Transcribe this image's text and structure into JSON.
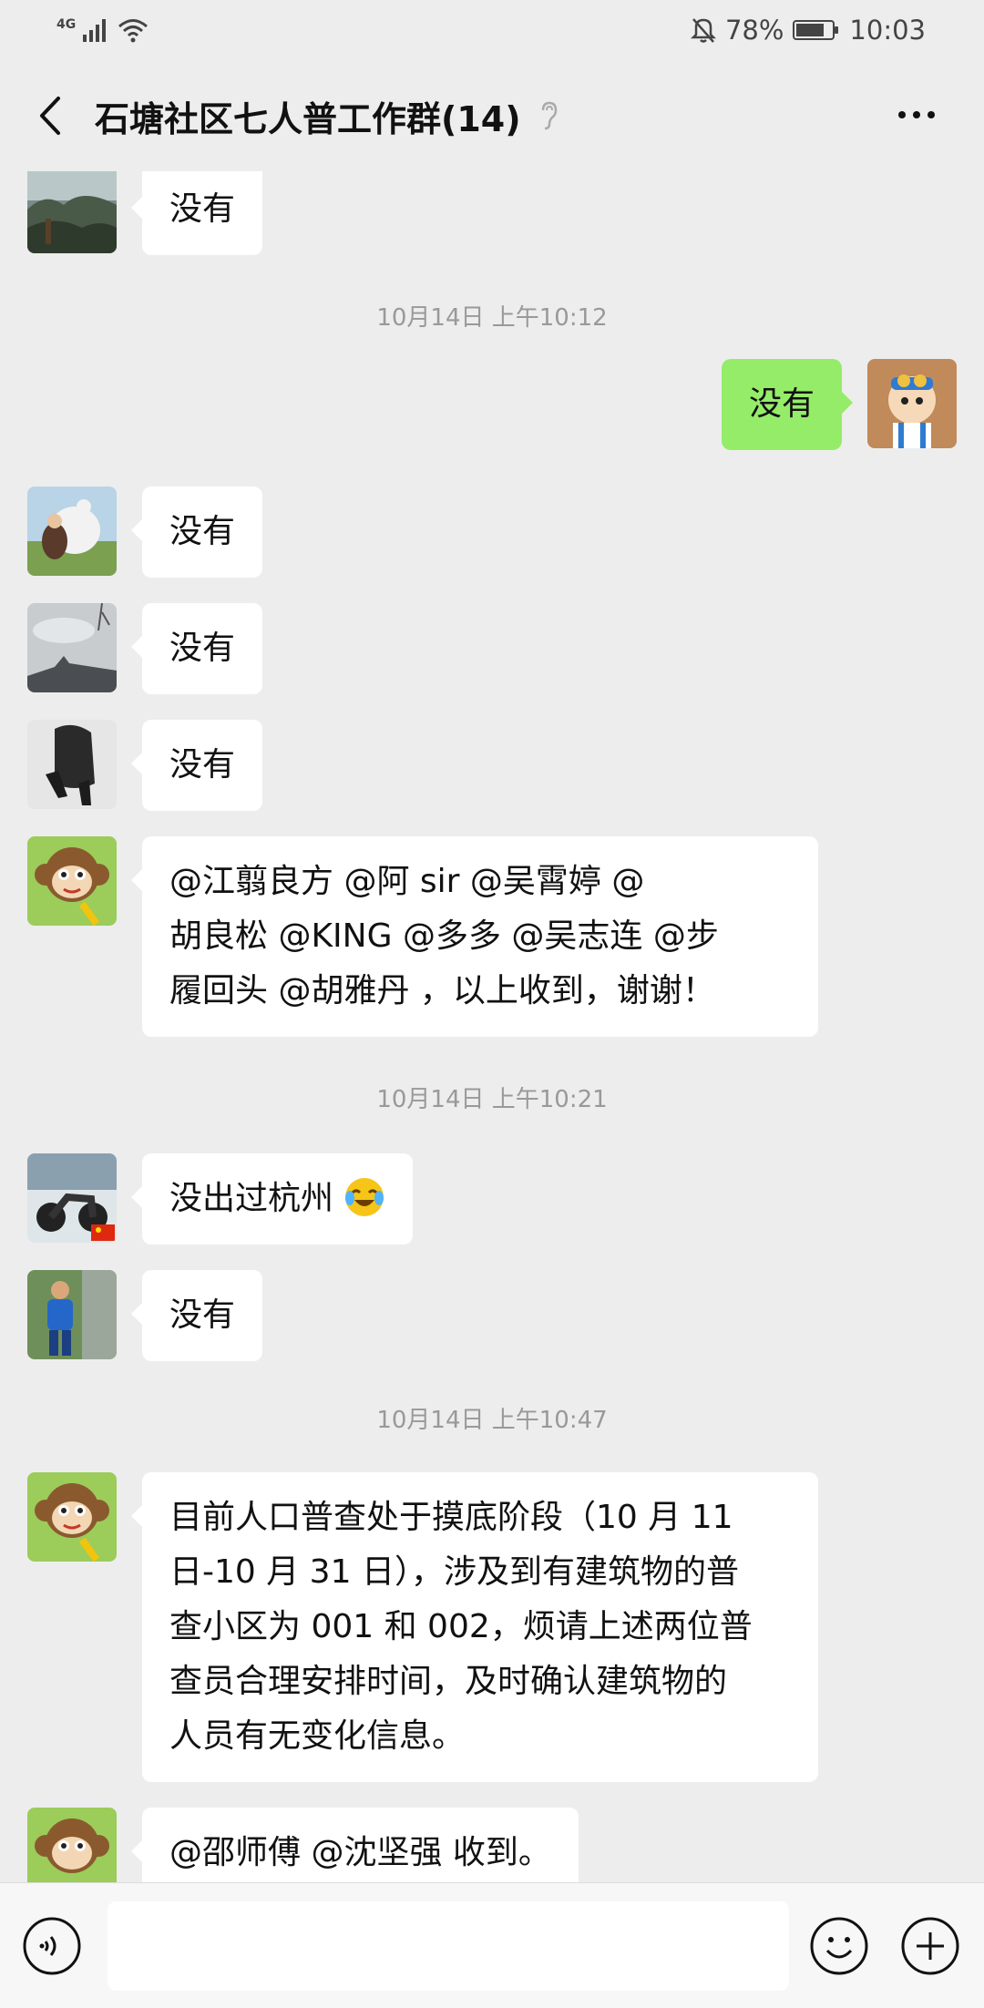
{
  "status_bar": {
    "network": "4G",
    "battery_percent": "78%",
    "time": "10:03"
  },
  "header": {
    "title": "石塘社区七人普工作群(14)"
  },
  "messages": [
    {
      "type": "text",
      "side": "left",
      "avatar": "landscape-avatar",
      "text": "没有"
    },
    {
      "type": "time",
      "text": "10月14日 上午10:12"
    },
    {
      "type": "text",
      "side": "right",
      "avatar": "cartoon-boy-avatar",
      "text": "没有"
    },
    {
      "type": "text",
      "side": "left",
      "avatar": "bear-avatar",
      "text": "没有"
    },
    {
      "type": "text",
      "side": "left",
      "avatar": "sky-avatar",
      "text": "没有"
    },
    {
      "type": "text",
      "side": "left",
      "avatar": "person-avatar",
      "text": "没有"
    },
    {
      "type": "text",
      "side": "left",
      "avatar": "monkey-avatar",
      "lines": [
        "@江翦良方 @阿 sir @吴霄婷 @",
        "胡良松 @KING @多多 @吴志连 @步",
        "履回头 @胡雅丹 ，以上收到，谢谢！"
      ]
    },
    {
      "type": "time",
      "text": "10月14日 上午10:21"
    },
    {
      "type": "text",
      "side": "left",
      "avatar": "motorcycle-avatar",
      "text": "没出过杭州"
    },
    {
      "type": "text",
      "side": "left",
      "avatar": "child-avatar",
      "text": "没有"
    },
    {
      "type": "time",
      "text": "10月14日 上午10:47"
    },
    {
      "type": "text",
      "side": "left",
      "avatar": "monkey-avatar",
      "lines": [
        "目前人口普查处于摸底阶段（10 月 11",
        "日-10 月 31 日），涉及到有建筑物的普",
        "查小区为 001 和 002，烦请上述两位普",
        "查员合理安排时间，及时确认建筑物的",
        "人员有无变化信息。"
      ]
    },
    {
      "type": "text",
      "side": "left",
      "avatar": "monkey-avatar",
      "text": "@邵师傅 @沈坚强  收到。"
    }
  ]
}
